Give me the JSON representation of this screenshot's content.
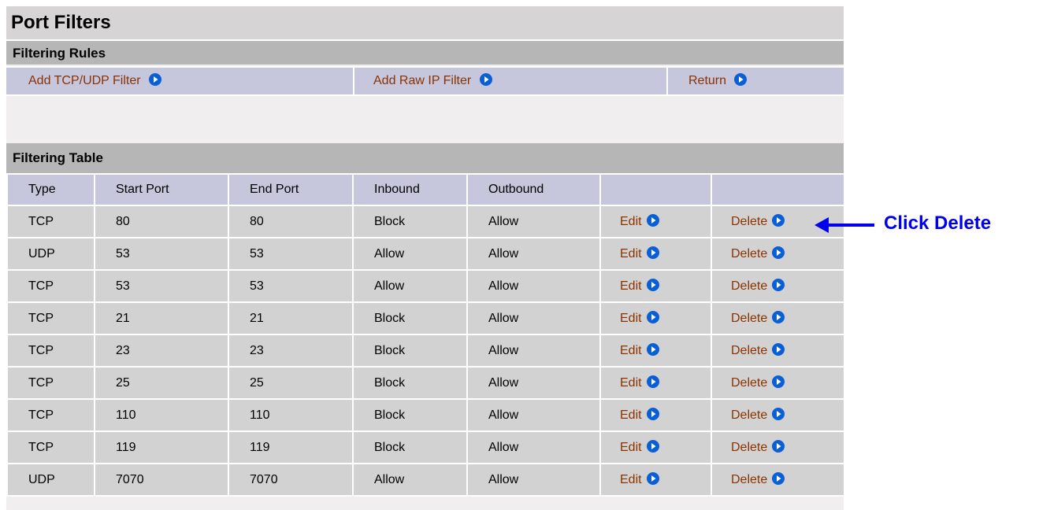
{
  "page": {
    "title": "Port Filters"
  },
  "rules": {
    "heading": "Filtering Rules",
    "links": {
      "add_tcp_udp": "Add TCP/UDP Filter",
      "add_raw_ip": "Add Raw IP Filter",
      "return": "Return"
    }
  },
  "table": {
    "heading": "Filtering Table",
    "columns": [
      "Type",
      "Start Port",
      "End Port",
      "Inbound",
      "Outbound",
      "",
      ""
    ],
    "edit_label": "Edit",
    "delete_label": "Delete",
    "rows": [
      [
        "TCP",
        "80",
        "80",
        "Block",
        "Allow"
      ],
      [
        "UDP",
        "53",
        "53",
        "Allow",
        "Allow"
      ],
      [
        "TCP",
        "53",
        "53",
        "Allow",
        "Allow"
      ],
      [
        "TCP",
        "21",
        "21",
        "Block",
        "Allow"
      ],
      [
        "TCP",
        "23",
        "23",
        "Block",
        "Allow"
      ],
      [
        "TCP",
        "25",
        "25",
        "Block",
        "Allow"
      ],
      [
        "TCP",
        "110",
        "110",
        "Block",
        "Allow"
      ],
      [
        "TCP",
        "119",
        "119",
        "Block",
        "Allow"
      ],
      [
        "UDP",
        "7070",
        "7070",
        "Allow",
        "Allow"
      ]
    ]
  },
  "annotation": {
    "text": "Click Delete",
    "color": "#0000ee"
  },
  "colors": {
    "link": "#8a3300",
    "icon": "#0a5fd6",
    "header_band": "#c6c6dd",
    "section": "#b7b6b6"
  },
  "icons": {
    "go": "arrow-circle-right-icon"
  }
}
